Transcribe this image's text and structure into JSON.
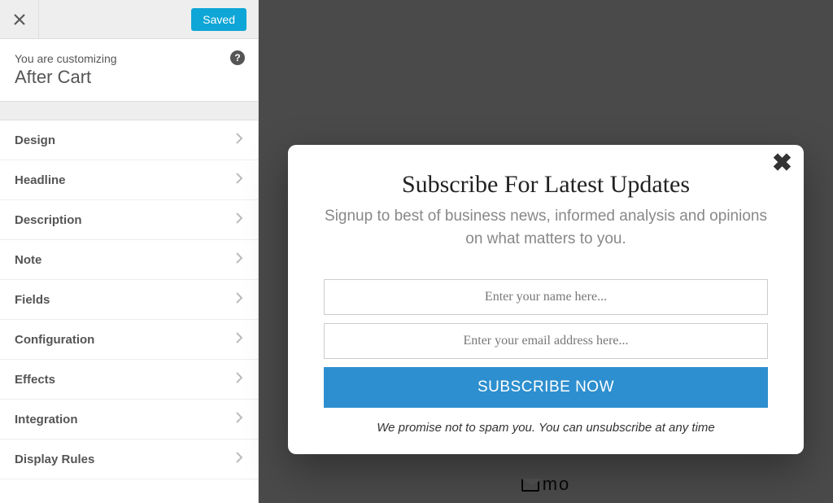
{
  "sidebar": {
    "saved_label": "Saved",
    "customizing_line1": "You are customizing",
    "customizing_line2": "After Cart",
    "help_glyph": "?",
    "items": [
      {
        "label": "Design"
      },
      {
        "label": "Headline"
      },
      {
        "label": "Description"
      },
      {
        "label": "Note"
      },
      {
        "label": "Fields"
      },
      {
        "label": "Configuration"
      },
      {
        "label": "Effects"
      },
      {
        "label": "Integration"
      },
      {
        "label": "Display Rules"
      }
    ]
  },
  "modal": {
    "close_glyph": "✖",
    "headline": "Subscribe For Latest Updates",
    "subtext": "Signup to best of business news, informed analysis and opinions on what matters to you.",
    "name_placeholder": "Enter your name here...",
    "email_placeholder": "Enter your email address here...",
    "button_label": "SUBSCRIBE NOW",
    "promise": "We promise not to spam you. You can unsubscribe at any time"
  },
  "footer": {
    "brand": "mo"
  }
}
